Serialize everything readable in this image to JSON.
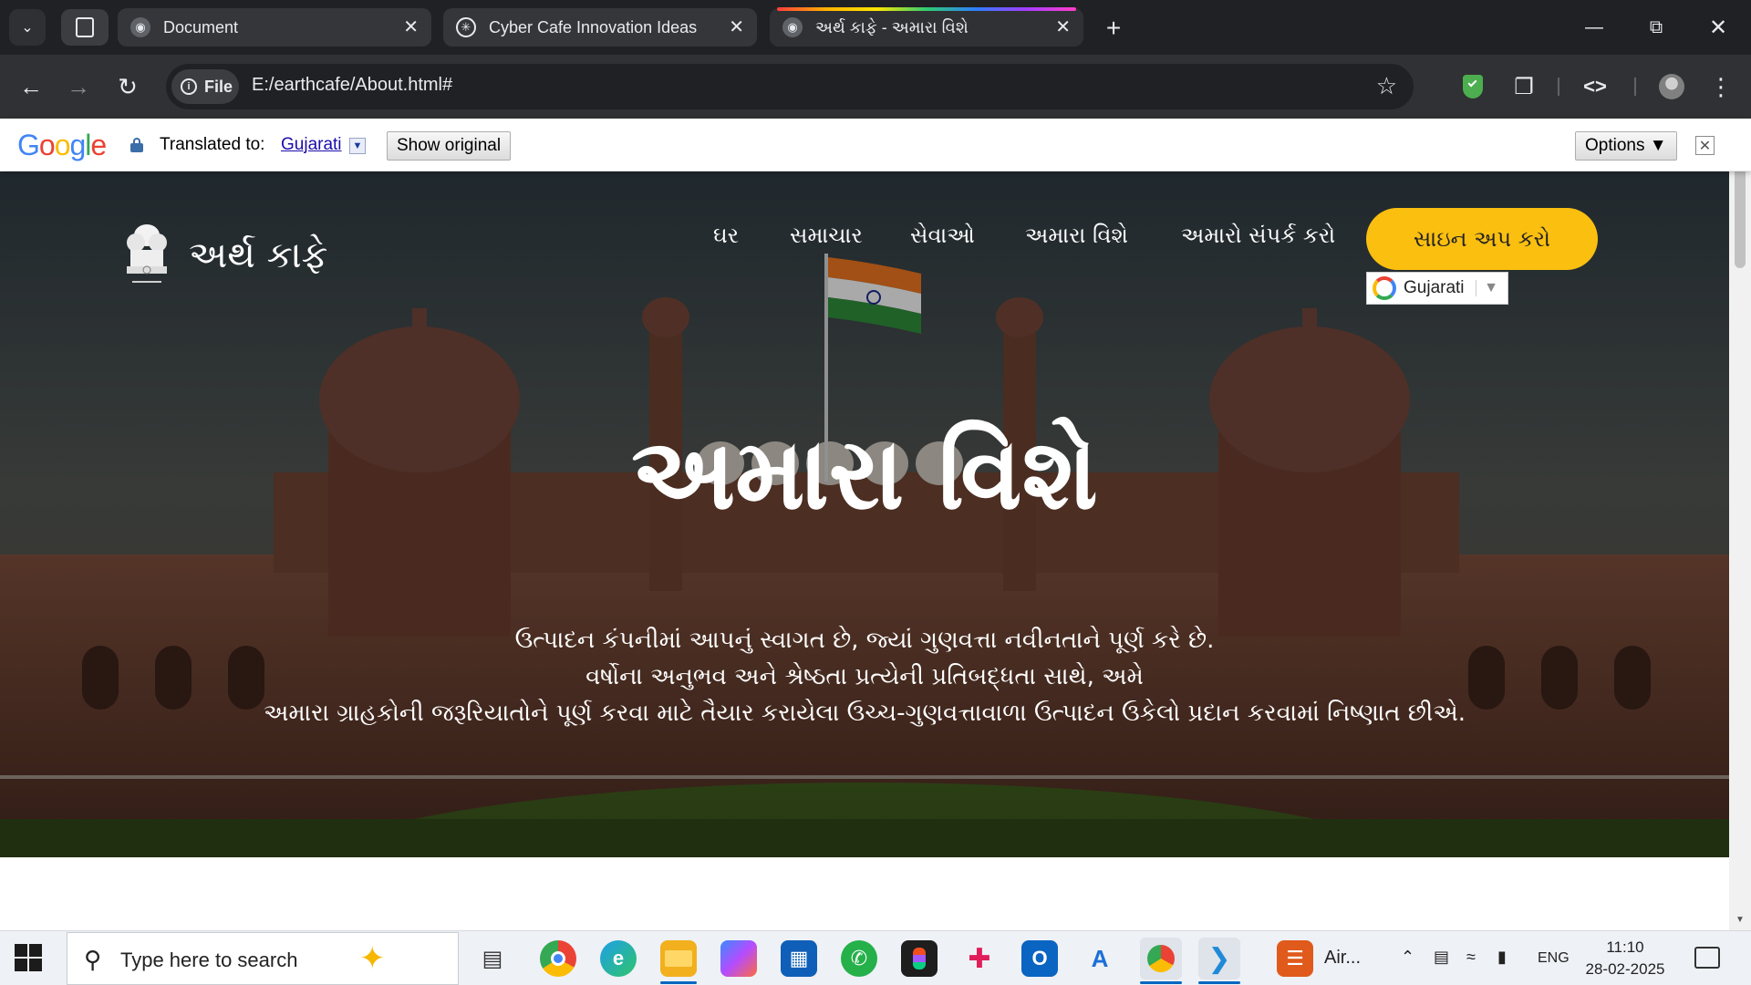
{
  "browser": {
    "tabs": [
      {
        "title": "Document",
        "favicon": "globe-icon"
      },
      {
        "title": "Cyber Cafe Innovation Ideas",
        "favicon": "chatgpt-icon"
      },
      {
        "title": "અર્થ કાફે - અમારા વિશે",
        "favicon": "globe-icon",
        "active": true
      }
    ],
    "new_tab": "+",
    "url_chip": "File",
    "url": "E:/earthcafe/About.html#"
  },
  "translate_bar": {
    "logo": "Google",
    "translated_to_label": "Translated to:",
    "language": "Gujarati",
    "show_original": "Show original",
    "options": "Options ▼",
    "close": "✕"
  },
  "site": {
    "brand_name": "અર્થ કાફે",
    "nav": [
      "ઘર",
      "સમાચાર",
      "સેવાઓ",
      "અમારા વિશે",
      "અમારો સંપર્ક કરો"
    ],
    "signup": "સાઇન અપ કરો",
    "lang_widget": "Gujarati",
    "hero_title": "અમારા વિશે",
    "hero_desc": [
      "ઉત્પાદન કંપનીમાં આપનું સ્વાગત છે, જ્યાં ગુણવત્તા નવીનતાને પૂર્ણ કરે છે.",
      "વર્ષોના અનુભવ અને શ્રેષ્ઠતા પ્રત્યેની પ્રતિબદ્ધતા સાથે, અમે",
      "અમારા ગ્રાહકોની જરૂરિયાતોને પૂર્ણ કરવા માટે તૈયાર કરાયેલા ઉચ્ચ-ગુણવત્તાવાળા ઉત્પાદન ઉકેલો પ્રદાન કરવામાં નિષ્ણાત છીએ."
    ],
    "accent_color": "#fbbf10"
  },
  "taskbar": {
    "search_placeholder": "Type here to search",
    "apps": [
      "task-view",
      "chrome",
      "edge",
      "file-explorer",
      "copilot",
      "microsoft-store",
      "whatsapp",
      "figma",
      "slack",
      "outlook",
      "app-a",
      "chrome-profile",
      "vscode",
      "air-app"
    ],
    "air_label": "Air...",
    "lang": "ENG",
    "time": "11:10",
    "date": "28-02-2025"
  }
}
